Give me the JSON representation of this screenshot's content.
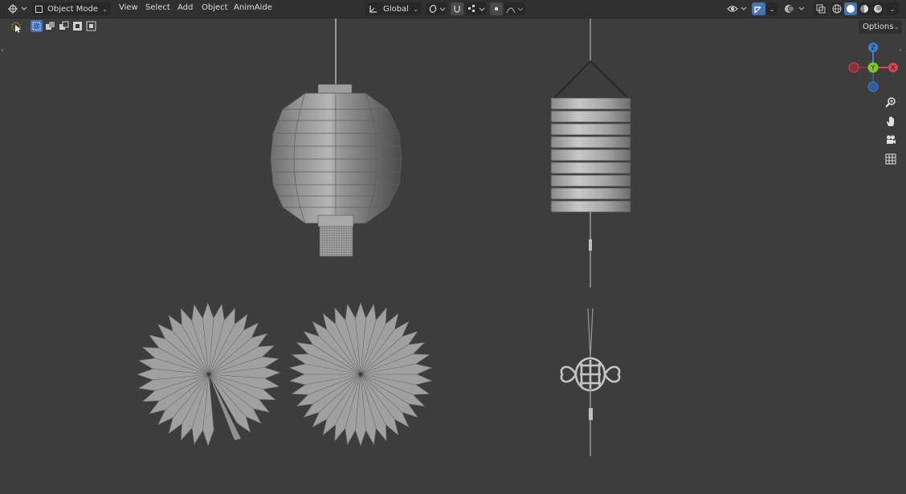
{
  "header": {
    "editor_type_icon": "3d-viewport-icon",
    "mode_dropdown": {
      "icon": "object-mode-icon",
      "value": "Object Mode"
    },
    "menus": [
      {
        "label": "View"
      },
      {
        "label": "Select"
      },
      {
        "label": "Add"
      },
      {
        "label": "Object"
      },
      {
        "label": "AnimAide"
      }
    ],
    "transform_orientation": {
      "icon": "orientation-icon",
      "value": "Global"
    },
    "pivot_icon": "pivot-link-icon",
    "snap_icon": "snap-magnet-icon",
    "snap_target_icon": "snap-increment-icon",
    "proportional_icon": "proportional-edit-icon",
    "falloff_icon": "falloff-curve-icon",
    "visibility_icon": "visibility-eye-icon",
    "gizmo_icon": "gizmo-toggle-icon",
    "overlay_icon": "overlays-icon",
    "xray_icon": "xray-icon",
    "shading_modes": [
      "wireframe-shading-icon",
      "solid-shading-icon",
      "material-shading-icon",
      "rendered-shading-icon"
    ],
    "active_shading": 1
  },
  "toolbar": {
    "tool_icon": "select-box-cursor-icon",
    "selection_modes": [
      "select-new-icon",
      "select-extend-icon",
      "select-subtract-icon",
      "select-invert-icon",
      "select-intersect-icon"
    ],
    "active_selection_mode": 0
  },
  "viewport": {
    "options_label": "Options",
    "gizmo_axes": {
      "z": "Z",
      "y": "Y",
      "x": "X"
    },
    "axis_colors": {
      "x": "#d8444f",
      "y": "#7ec724",
      "z": "#3b7fd3"
    },
    "nav_icons": [
      "zoom-icon",
      "pan-hand-icon",
      "camera-icon",
      "perspective-grid-icon"
    ]
  },
  "colors": {
    "header_bg": "#303030",
    "viewport_bg": "#3d3d3d",
    "active_button": "#4772b3",
    "mesh_gray": "#9c9c9c"
  }
}
